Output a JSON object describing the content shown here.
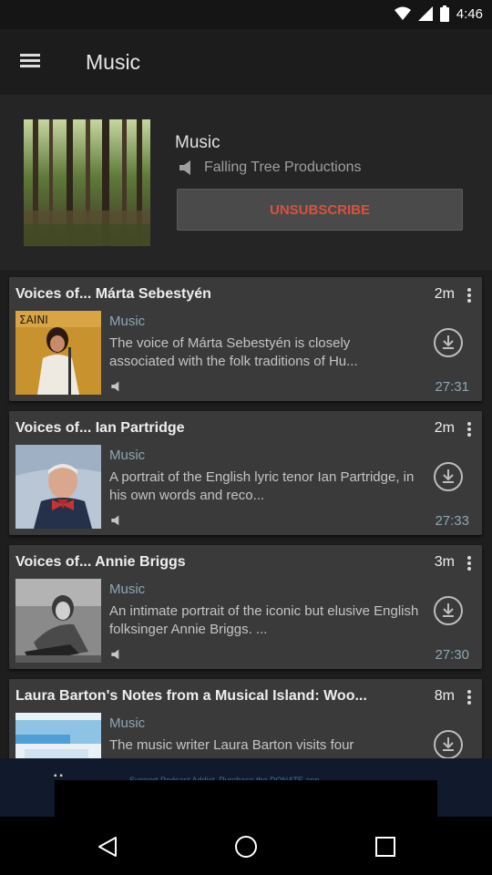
{
  "status_bar": {
    "time": "4:46"
  },
  "app_bar": {
    "title": "Music"
  },
  "podcast": {
    "name": "Music",
    "author": "Falling Tree Productions",
    "unsubscribe_label": "UNSUBSCRIBE"
  },
  "episodes": [
    {
      "title": "Voices of... Márta Sebestyén",
      "age": "2m",
      "category": "Music",
      "description": "The voice of Márta Sebestyén is closely associated with the folk traditions of Hu...",
      "duration": "27:31"
    },
    {
      "title": "Voices of... Ian Partridge",
      "age": "2m",
      "category": "Music",
      "description": "A portrait of the English lyric tenor Ian Partridge, in his own words and reco...",
      "duration": "27:33"
    },
    {
      "title": "Voices of... Annie Briggs",
      "age": "3m",
      "category": "Music",
      "description": "An intimate portrait of the iconic but elusive English folksinger Annie Briggs. ...",
      "duration": "27:30"
    },
    {
      "title": "Laura Barton's Notes from a Musical Island: Woo...",
      "age": "8m",
      "category": "Music",
      "description": "The music writer Laura Barton visits four",
      "duration": ""
    }
  ],
  "ad_banner": {
    "text": "Support Podcast Addict. Purchase the DONATE app"
  }
}
